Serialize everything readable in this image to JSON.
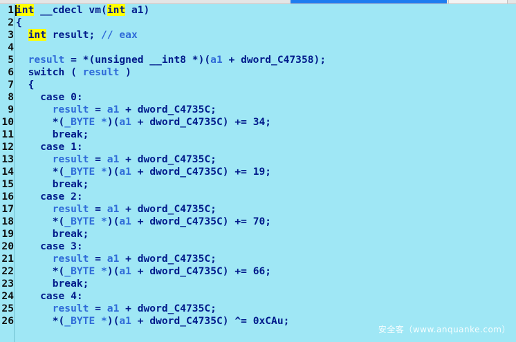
{
  "lines": [
    {
      "n": "1",
      "tokens": [
        {
          "t": "int",
          "c": "hl"
        },
        {
          "t": " __cdecl vm(",
          "c": "kw"
        },
        {
          "t": "int",
          "c": "hl"
        },
        {
          "t": " a1)",
          "c": "kw"
        }
      ]
    },
    {
      "n": "2",
      "tokens": [
        {
          "t": "{",
          "c": "kw"
        }
      ]
    },
    {
      "n": "3",
      "tokens": [
        {
          "t": "  ",
          "c": "kw"
        },
        {
          "t": "int",
          "c": "hl"
        },
        {
          "t": " result; ",
          "c": "kw"
        },
        {
          "t": "// eax",
          "c": "cm"
        }
      ]
    },
    {
      "n": "4",
      "tokens": []
    },
    {
      "n": "5",
      "tokens": [
        {
          "t": "  ",
          "c": "kw"
        },
        {
          "t": "result",
          "c": "var"
        },
        {
          "t": " = *(unsigned __int8 *)(",
          "c": "kw"
        },
        {
          "t": "a1",
          "c": "var"
        },
        {
          "t": " + dword_C47358);",
          "c": "kw"
        }
      ]
    },
    {
      "n": "6",
      "tokens": [
        {
          "t": "  switch ( ",
          "c": "kw"
        },
        {
          "t": "result",
          "c": "var"
        },
        {
          "t": " )",
          "c": "kw"
        }
      ]
    },
    {
      "n": "7",
      "tokens": [
        {
          "t": "  {",
          "c": "kw"
        }
      ]
    },
    {
      "n": "8",
      "tokens": [
        {
          "t": "    case 0:",
          "c": "kw"
        }
      ]
    },
    {
      "n": "9",
      "tokens": [
        {
          "t": "      ",
          "c": "kw"
        },
        {
          "t": "result",
          "c": "var"
        },
        {
          "t": " = ",
          "c": "kw"
        },
        {
          "t": "a1",
          "c": "var"
        },
        {
          "t": " + dword_C4735C;",
          "c": "kw"
        }
      ]
    },
    {
      "n": "10",
      "tokens": [
        {
          "t": "      *(",
          "c": "kw"
        },
        {
          "t": "_BYTE *",
          "c": "var"
        },
        {
          "t": ")(",
          "c": "kw"
        },
        {
          "t": "a1",
          "c": "var"
        },
        {
          "t": " + dword_C4735C) += 34;",
          "c": "kw"
        }
      ]
    },
    {
      "n": "11",
      "tokens": [
        {
          "t": "      break;",
          "c": "kw"
        }
      ]
    },
    {
      "n": "12",
      "tokens": [
        {
          "t": "    case 1:",
          "c": "kw"
        }
      ]
    },
    {
      "n": "13",
      "tokens": [
        {
          "t": "      ",
          "c": "kw"
        },
        {
          "t": "result",
          "c": "var"
        },
        {
          "t": " = ",
          "c": "kw"
        },
        {
          "t": "a1",
          "c": "var"
        },
        {
          "t": " + dword_C4735C;",
          "c": "kw"
        }
      ]
    },
    {
      "n": "14",
      "tokens": [
        {
          "t": "      *(",
          "c": "kw"
        },
        {
          "t": "_BYTE *",
          "c": "var"
        },
        {
          "t": ")(",
          "c": "kw"
        },
        {
          "t": "a1",
          "c": "var"
        },
        {
          "t": " + dword_C4735C) += 19;",
          "c": "kw"
        }
      ]
    },
    {
      "n": "15",
      "tokens": [
        {
          "t": "      break;",
          "c": "kw"
        }
      ]
    },
    {
      "n": "16",
      "tokens": [
        {
          "t": "    case 2:",
          "c": "kw"
        }
      ]
    },
    {
      "n": "17",
      "tokens": [
        {
          "t": "      ",
          "c": "kw"
        },
        {
          "t": "result",
          "c": "var"
        },
        {
          "t": " = ",
          "c": "kw"
        },
        {
          "t": "a1",
          "c": "var"
        },
        {
          "t": " + dword_C4735C;",
          "c": "kw"
        }
      ]
    },
    {
      "n": "18",
      "tokens": [
        {
          "t": "      *(",
          "c": "kw"
        },
        {
          "t": "_BYTE *",
          "c": "var"
        },
        {
          "t": ")(",
          "c": "kw"
        },
        {
          "t": "a1",
          "c": "var"
        },
        {
          "t": " + dword_C4735C) += 70;",
          "c": "kw"
        }
      ]
    },
    {
      "n": "19",
      "tokens": [
        {
          "t": "      break;",
          "c": "kw"
        }
      ]
    },
    {
      "n": "20",
      "tokens": [
        {
          "t": "    case 3:",
          "c": "kw"
        }
      ]
    },
    {
      "n": "21",
      "tokens": [
        {
          "t": "      ",
          "c": "kw"
        },
        {
          "t": "result",
          "c": "var"
        },
        {
          "t": " = ",
          "c": "kw"
        },
        {
          "t": "a1",
          "c": "var"
        },
        {
          "t": " + dword_C4735C;",
          "c": "kw"
        }
      ]
    },
    {
      "n": "22",
      "tokens": [
        {
          "t": "      *(",
          "c": "kw"
        },
        {
          "t": "_BYTE *",
          "c": "var"
        },
        {
          "t": ")(",
          "c": "kw"
        },
        {
          "t": "a1",
          "c": "var"
        },
        {
          "t": " + dword_C4735C) += 66;",
          "c": "kw"
        }
      ]
    },
    {
      "n": "23",
      "tokens": [
        {
          "t": "      break;",
          "c": "kw"
        }
      ]
    },
    {
      "n": "24",
      "tokens": [
        {
          "t": "    case 4:",
          "c": "kw"
        }
      ]
    },
    {
      "n": "25",
      "tokens": [
        {
          "t": "      ",
          "c": "kw"
        },
        {
          "t": "result",
          "c": "var"
        },
        {
          "t": " = ",
          "c": "kw"
        },
        {
          "t": "a1",
          "c": "var"
        },
        {
          "t": " + dword_C4735C;",
          "c": "kw"
        }
      ]
    },
    {
      "n": "26",
      "tokens": [
        {
          "t": "      *(",
          "c": "kw"
        },
        {
          "t": "_BYTE *",
          "c": "var"
        },
        {
          "t": ")(",
          "c": "kw"
        },
        {
          "t": "a1",
          "c": "var"
        },
        {
          "t": " + dword_C4735C) ^= 0xCAu;",
          "c": "kw"
        }
      ]
    }
  ],
  "watermark": "安全客（www.anquanke.com）",
  "colors": {
    "background": "#9fe7f5",
    "keyword": "#001a8a",
    "variable": "#2f6bd8",
    "highlight": "#ffff00",
    "tab_active": "#1e7cf0"
  }
}
